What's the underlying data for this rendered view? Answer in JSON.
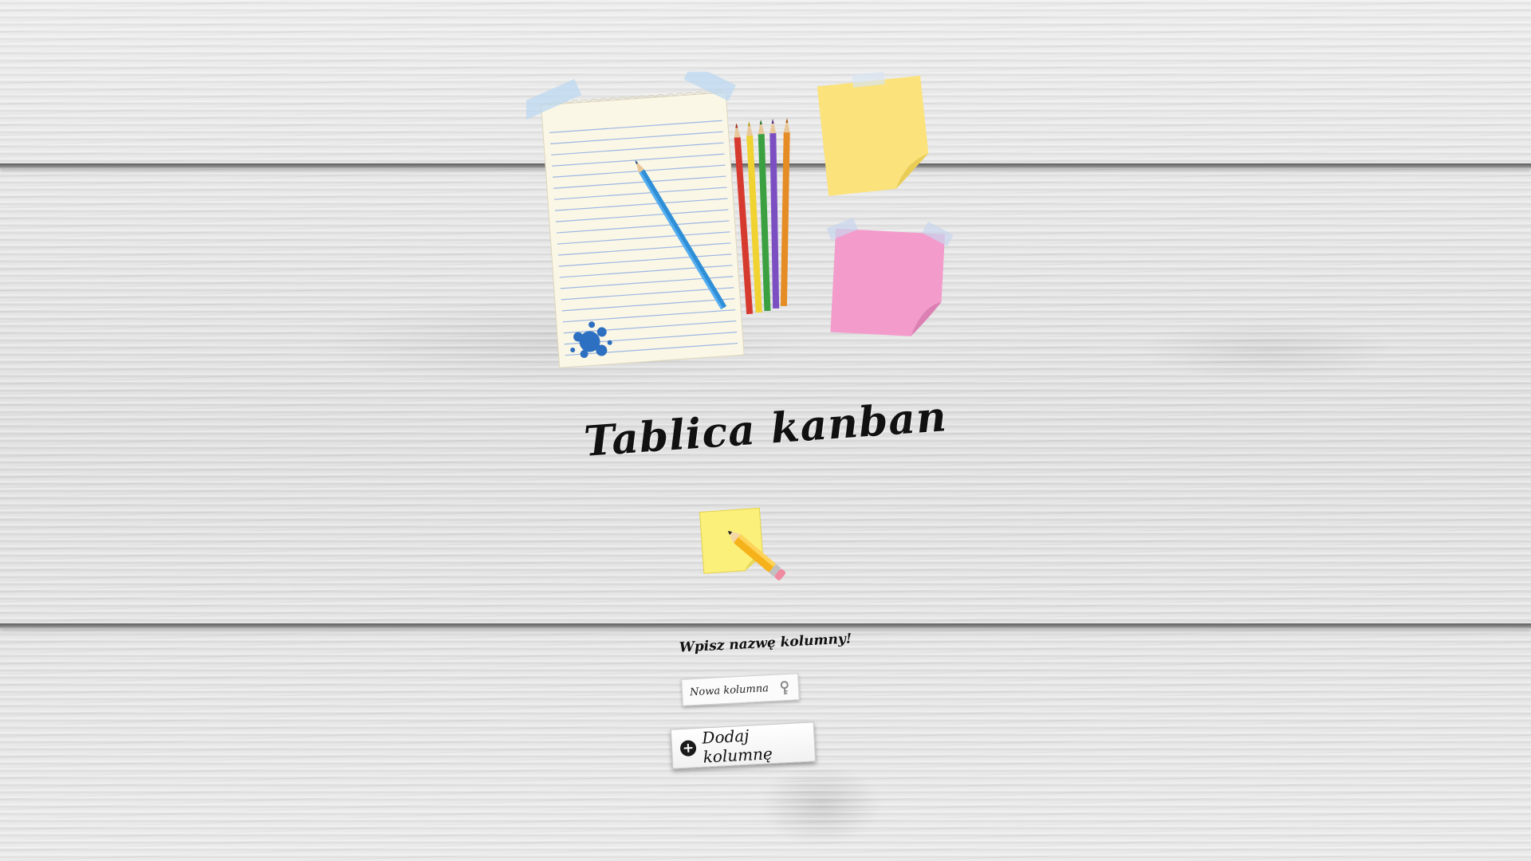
{
  "header": {
    "title": "Tablica kanban",
    "illustration_icon": "stationery-illustration-icon"
  },
  "form": {
    "note_icon": "sticky-note-pencil-icon",
    "prompt": "Wpisz nazwę kolumny!",
    "input": {
      "value": "",
      "placeholder": "Nowa kolumna",
      "icon": "key-icon"
    },
    "add_button": {
      "label": "Dodaj kolumnę",
      "icon": "plus-circle-icon"
    }
  },
  "colors": {
    "background": "#e7e7e7",
    "text": "#111111",
    "sticky_yellow": "#fbe27a",
    "sticky_pink": "#f39ccc"
  }
}
